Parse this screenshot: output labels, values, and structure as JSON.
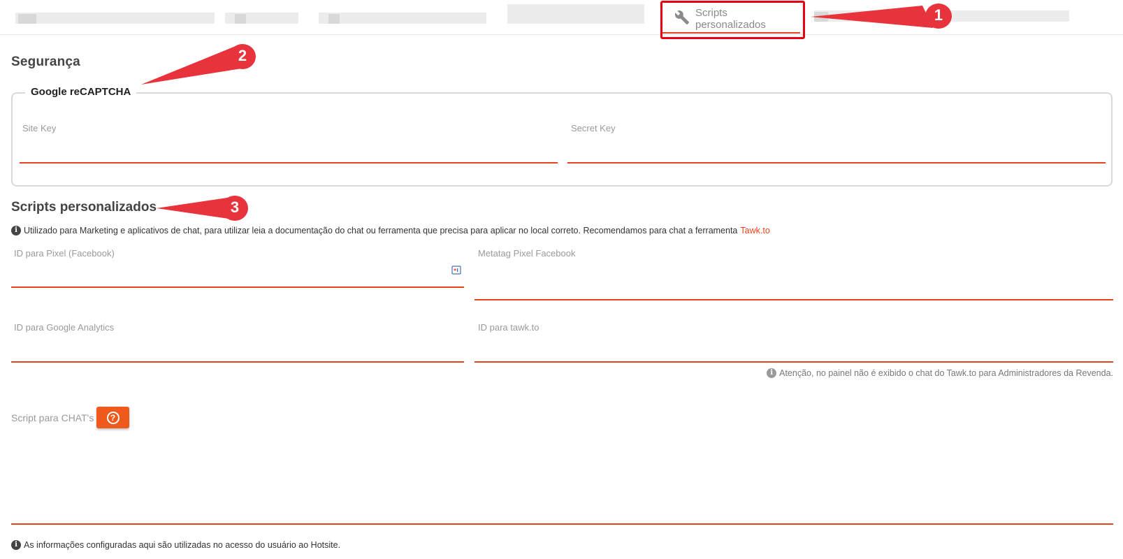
{
  "tabs": {
    "active_label": "Scripts personalizados",
    "active_icon": "wrench-icon"
  },
  "security": {
    "title": "Segurança",
    "recaptcha": {
      "legend": "Google reCAPTCHA",
      "site_key_label": "Site Key",
      "secret_key_label": "Secret Key"
    }
  },
  "scripts": {
    "title": "Scripts personalizados",
    "info_text": "Utilizado para Marketing e aplicativos de chat, para utilizar leia a documentação do chat ou ferramenta que precisa para aplicar no local correto. Recomendamos para chat a ferramenta",
    "info_link": "Tawk.to",
    "pixel_label": "ID para Pixel (Facebook)",
    "metatag_label": "Metatag Pixel Facebook",
    "analytics_label": "ID para Google Analytics",
    "tawk_label": "ID para tawk.to",
    "tawk_note": "Atenção, no painel não é exibido o chat do Tawk.to para Administradores da Revenda.",
    "chat_label": "Script para CHAT's",
    "help_symbol": "?",
    "footer_note": "As informações configuradas aqui são utilizadas no acesso do usuário ao Hotsite."
  },
  "annotations": {
    "badge_1": "1",
    "badge_2": "2",
    "badge_3": "3",
    "color": "#e8323c"
  },
  "colors": {
    "accent": "#e8451e",
    "highlight_box": "#e60012",
    "button": "#f0591c"
  }
}
